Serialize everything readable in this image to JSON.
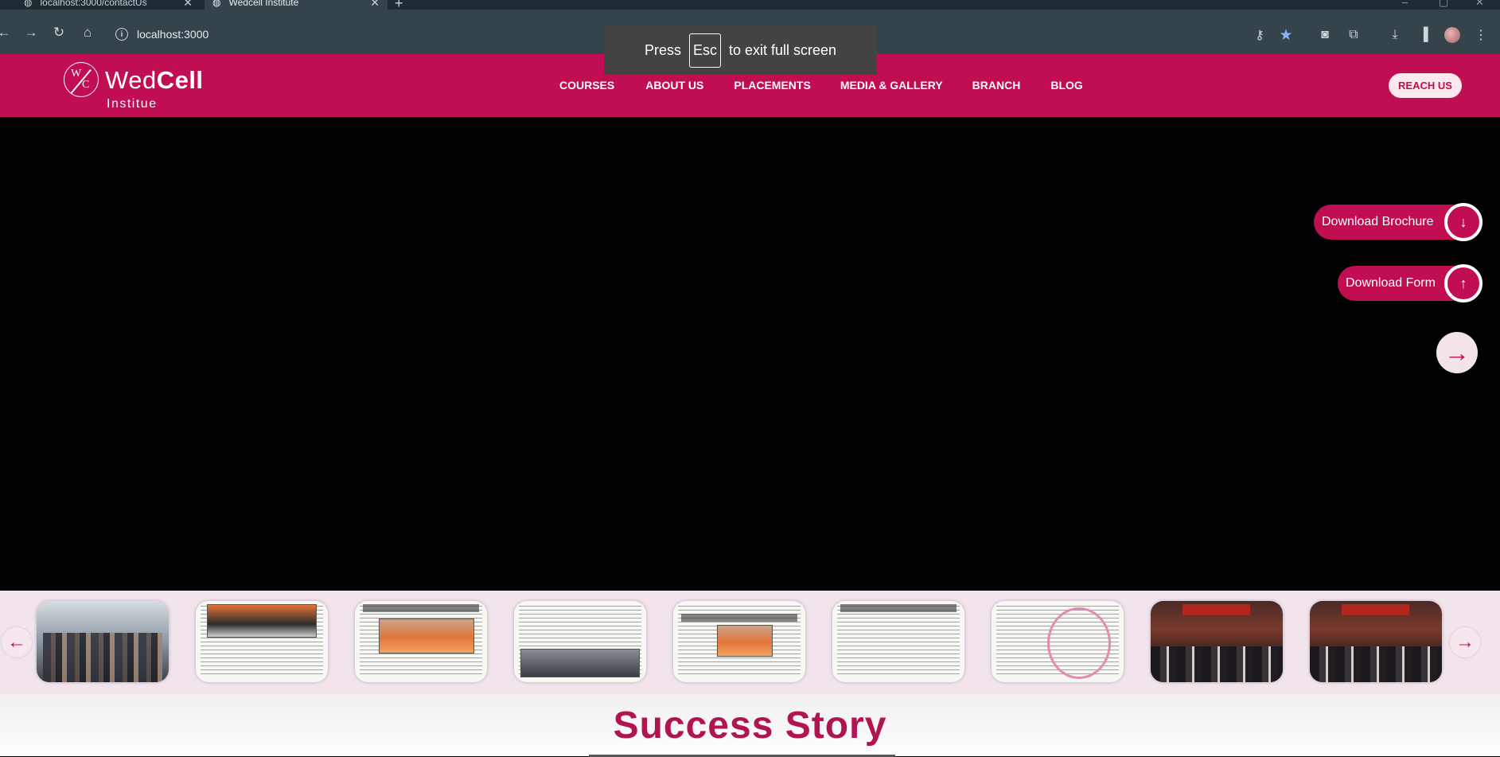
{
  "browser": {
    "tabs": [
      {
        "title": "localhost:3000/contactUs"
      },
      {
        "title": "Wedcell Institute"
      }
    ],
    "address": "localhost:3000",
    "fullscreen_notice": {
      "press": "Press",
      "key": "Esc",
      "rest": "to exit full screen"
    }
  },
  "header": {
    "logo": {
      "mark_w": "W",
      "mark_c": "C",
      "wed": "Wed",
      "cell": "Cell",
      "sub": "Institue"
    },
    "nav": [
      "COURSES",
      "ABOUT US",
      "PLACEMENTS",
      "MEDIA & GALLERY",
      "BRANCH",
      "BLOG"
    ],
    "reach_label": "REACH US",
    "brand_color": "#c10d52"
  },
  "hero": {
    "brochure_label": "Download Brochure",
    "form_label": "Download Form"
  },
  "gallery": {
    "items": [
      {
        "kind": "photo",
        "label": "group-photo"
      },
      {
        "kind": "paper",
        "label": "newspaper-clipping-1"
      },
      {
        "kind": "paper",
        "label": "newspaper-clipping-2"
      },
      {
        "kind": "paper",
        "label": "newspaper-clipping-3"
      },
      {
        "kind": "paper",
        "label": "newspaper-clipping-4"
      },
      {
        "kind": "paper",
        "label": "newspaper-clipping-5"
      },
      {
        "kind": "paper",
        "label": "newspaper-clipping-6"
      },
      {
        "kind": "event",
        "label": "event-photo-1"
      },
      {
        "kind": "event",
        "label": "event-photo-2"
      }
    ]
  },
  "success": {
    "title": "Success Story"
  }
}
